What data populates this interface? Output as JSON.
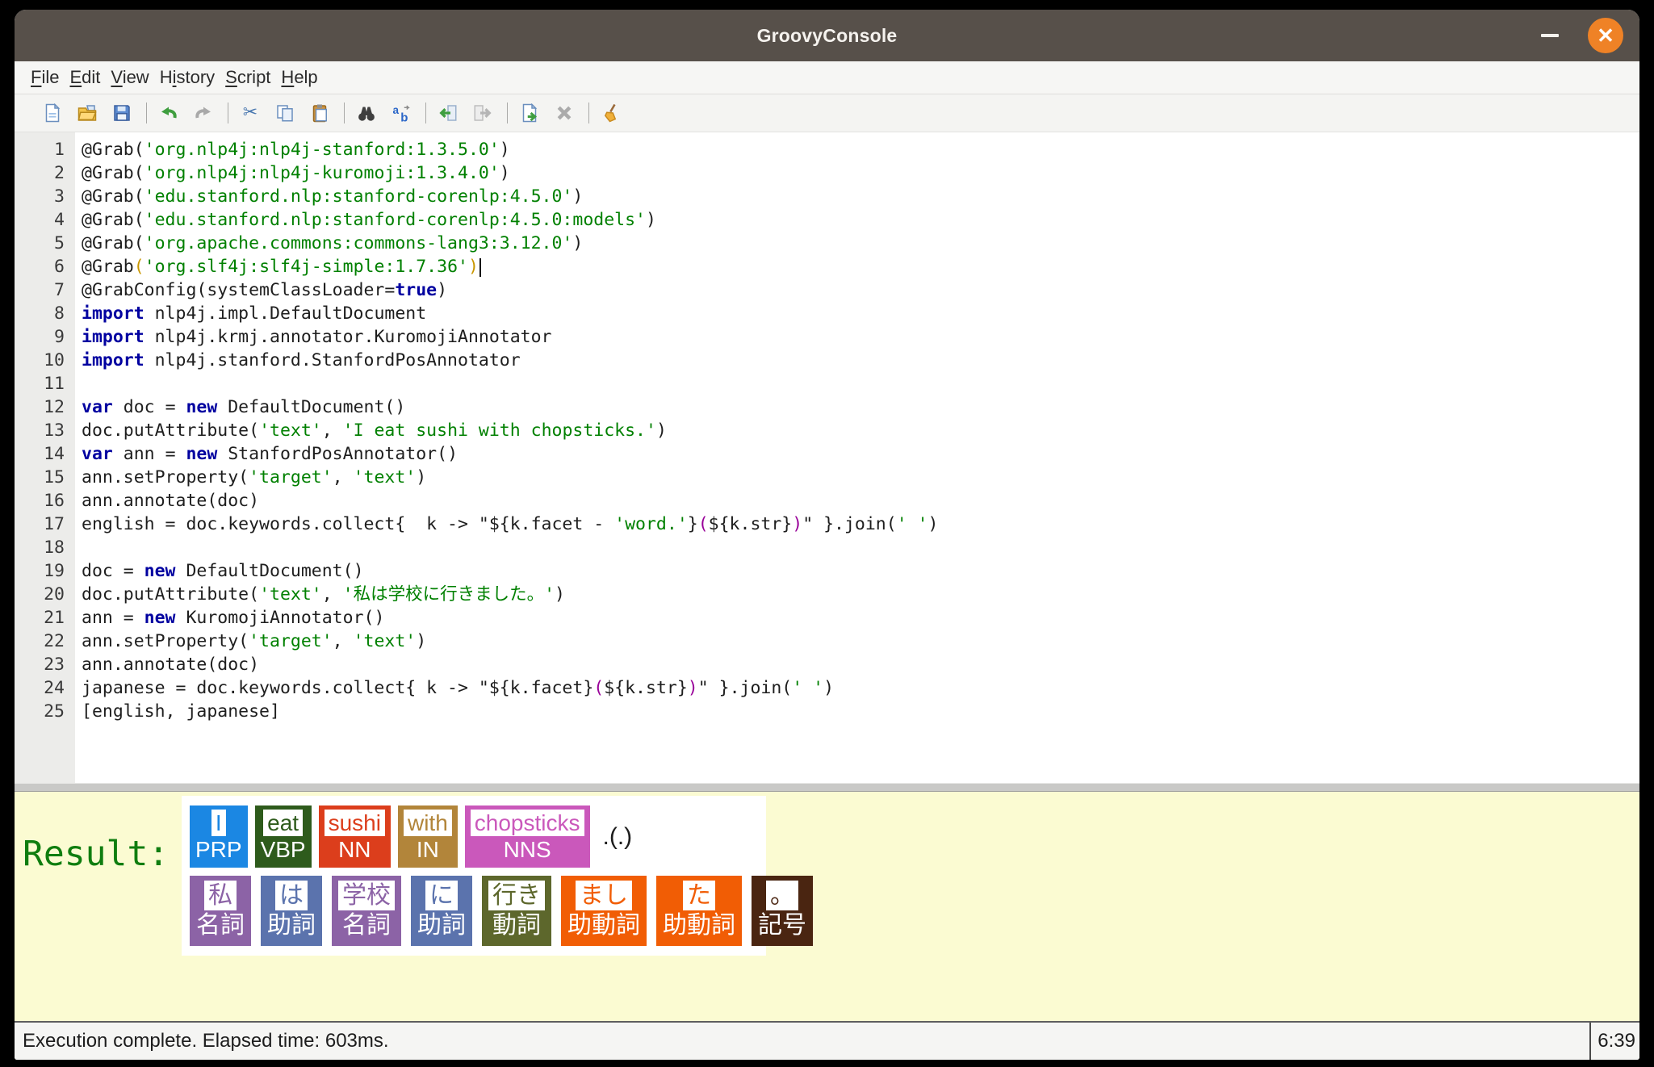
{
  "window": {
    "title": "GroovyConsole"
  },
  "titlebar_controls": {
    "minimize": "–",
    "close": "✕"
  },
  "menu": {
    "items": [
      {
        "pre": "",
        "m": "F",
        "post": "ile"
      },
      {
        "pre": "",
        "m": "E",
        "post": "dit"
      },
      {
        "pre": "",
        "m": "V",
        "post": "iew"
      },
      {
        "pre": "H",
        "m": "i",
        "post": "story"
      },
      {
        "pre": "",
        "m": "S",
        "post": "cript"
      },
      {
        "pre": "",
        "m": "H",
        "post": "elp"
      }
    ]
  },
  "toolbar": {
    "groups": [
      [
        "new-file",
        "open-file",
        "save"
      ],
      [
        "undo",
        "redo"
      ],
      [
        "cut",
        "copy",
        "paste"
      ],
      [
        "find",
        "replace"
      ],
      [
        "history-previous",
        "history-next"
      ],
      [
        "execute",
        "interrupt"
      ],
      [
        "clear-output"
      ]
    ]
  },
  "editor": {
    "lines": [
      {
        "no": 1,
        "segs": [
          {
            "t": "@Grab("
          },
          {
            "t": "'org.nlp4j:nlp4j-stanford:1.3.5.0'",
            "c": "s"
          },
          {
            "t": ")"
          }
        ]
      },
      {
        "no": 2,
        "segs": [
          {
            "t": "@Grab("
          },
          {
            "t": "'org.nlp4j:nlp4j-kuromoji:1.3.4.0'",
            "c": "s"
          },
          {
            "t": ")"
          }
        ]
      },
      {
        "no": 3,
        "segs": [
          {
            "t": "@Grab("
          },
          {
            "t": "'edu.stanford.nlp:stanford-corenlp:4.5.0'",
            "c": "s"
          },
          {
            "t": ")"
          }
        ]
      },
      {
        "no": 4,
        "segs": [
          {
            "t": "@Grab("
          },
          {
            "t": "'edu.stanford.nlp:stanford-corenlp:4.5.0:models'",
            "c": "s"
          },
          {
            "t": ")"
          }
        ]
      },
      {
        "no": 5,
        "segs": [
          {
            "t": "@Grab("
          },
          {
            "t": "'org.apache.commons:commons-lang3:3.12.0'",
            "c": "s"
          },
          {
            "t": ")"
          }
        ]
      },
      {
        "no": 6,
        "segs": [
          {
            "t": "@Grab"
          },
          {
            "t": "(",
            "c": "b"
          },
          {
            "t": "'org.slf4j:slf4j-simple:1.7.36'",
            "c": "s"
          },
          {
            "t": ")",
            "c": "b"
          },
          {
            "caret": true
          }
        ]
      },
      {
        "no": 7,
        "segs": [
          {
            "t": "@GrabConfig(systemClassLoader="
          },
          {
            "t": "true",
            "c": "k"
          },
          {
            "t": ")"
          }
        ]
      },
      {
        "no": 8,
        "segs": [
          {
            "t": "import",
            "c": "k"
          },
          {
            "t": " nlp4j.impl.DefaultDocument"
          }
        ]
      },
      {
        "no": 9,
        "segs": [
          {
            "t": "import",
            "c": "k"
          },
          {
            "t": " nlp4j.krmj.annotator.KuromojiAnnotator"
          }
        ]
      },
      {
        "no": 10,
        "segs": [
          {
            "t": "import",
            "c": "k"
          },
          {
            "t": " nlp4j.stanford.StanfordPosAnnotator"
          }
        ]
      },
      {
        "no": 11,
        "segs": []
      },
      {
        "no": 12,
        "segs": [
          {
            "t": "var",
            "c": "k"
          },
          {
            "t": " doc = "
          },
          {
            "t": "new",
            "c": "k"
          },
          {
            "t": " DefaultDocument()"
          }
        ]
      },
      {
        "no": 13,
        "segs": [
          {
            "t": "doc.putAttribute("
          },
          {
            "t": "'text'",
            "c": "s"
          },
          {
            "t": ", "
          },
          {
            "t": "'I eat sushi with chopsticks.'",
            "c": "s"
          },
          {
            "t": ")"
          }
        ]
      },
      {
        "no": 14,
        "segs": [
          {
            "t": "var",
            "c": "k"
          },
          {
            "t": " ann = "
          },
          {
            "t": "new",
            "c": "k"
          },
          {
            "t": " StanfordPosAnnotator()"
          }
        ]
      },
      {
        "no": 15,
        "segs": [
          {
            "t": "ann.setProperty("
          },
          {
            "t": "'target'",
            "c": "s"
          },
          {
            "t": ", "
          },
          {
            "t": "'text'",
            "c": "s"
          },
          {
            "t": ")"
          }
        ]
      },
      {
        "no": 16,
        "segs": [
          {
            "t": "ann.annotate(doc)"
          }
        ]
      },
      {
        "no": 17,
        "segs": [
          {
            "t": "english = doc.keywords.collect{  k -> \"${k.facet - "
          },
          {
            "t": "'word.'",
            "c": "s"
          },
          {
            "t": "}"
          },
          {
            "t": "(",
            "c": "p"
          },
          {
            "t": "${k.str}"
          },
          {
            "t": ")",
            "c": "p"
          },
          {
            "t": "\" }.join("
          },
          {
            "t": "' '",
            "c": "s"
          },
          {
            "t": ")"
          }
        ]
      },
      {
        "no": 18,
        "segs": []
      },
      {
        "no": 19,
        "segs": [
          {
            "t": "doc = "
          },
          {
            "t": "new",
            "c": "k"
          },
          {
            "t": " DefaultDocument()"
          }
        ]
      },
      {
        "no": 20,
        "segs": [
          {
            "t": "doc.putAttribute("
          },
          {
            "t": "'text'",
            "c": "s"
          },
          {
            "t": ", "
          },
          {
            "t": "'私は学校に行きました。'",
            "c": "s"
          },
          {
            "t": ")"
          }
        ]
      },
      {
        "no": 21,
        "segs": [
          {
            "t": "ann = "
          },
          {
            "t": "new",
            "c": "k"
          },
          {
            "t": " KuromojiAnnotator()"
          }
        ]
      },
      {
        "no": 22,
        "segs": [
          {
            "t": "ann.setProperty("
          },
          {
            "t": "'target'",
            "c": "s"
          },
          {
            "t": ", "
          },
          {
            "t": "'text'",
            "c": "s"
          },
          {
            "t": ")"
          }
        ]
      },
      {
        "no": 23,
        "segs": [
          {
            "t": "ann.annotate(doc)"
          }
        ]
      },
      {
        "no": 24,
        "segs": [
          {
            "t": "japanese = doc.keywords.collect{ k -> \"${k.facet}"
          },
          {
            "t": "(",
            "c": "p"
          },
          {
            "t": "${k.str}"
          },
          {
            "t": ")",
            "c": "p"
          },
          {
            "t": "\" }.join("
          },
          {
            "t": "' '",
            "c": "s"
          },
          {
            "t": ")"
          }
        ]
      },
      {
        "no": 25,
        "segs": [
          {
            "t": "[english, japanese]"
          }
        ]
      }
    ]
  },
  "result": {
    "label": "Result:",
    "english": [
      {
        "word": "I",
        "tag": "PRP",
        "color": "#1b87e3"
      },
      {
        "word": "eat",
        "tag": "VBP",
        "color": "#2e5b1c"
      },
      {
        "word": "sushi",
        "tag": "NN",
        "color": "#dc3e1c"
      },
      {
        "word": "with",
        "tag": "IN",
        "color": "#b2853a"
      },
      {
        "word": "chopsticks",
        "tag": "NNS",
        "color": "#ca58bb"
      }
    ],
    "english_extra": ".(.)",
    "japanese": [
      {
        "word": "私",
        "tag": "名詞",
        "color": "#8c63a6"
      },
      {
        "word": "は",
        "tag": "助詞",
        "color": "#5b73ad"
      },
      {
        "word": "学校",
        "tag": "名詞",
        "color": "#8c63a6"
      },
      {
        "word": "に",
        "tag": "助詞",
        "color": "#5b73ad"
      },
      {
        "word": "行き",
        "tag": "動詞",
        "color": "#5d672c"
      },
      {
        "word": "まし",
        "tag": "助動詞",
        "color": "#f15d05"
      },
      {
        "word": "た",
        "tag": "助動詞",
        "color": "#f15d05"
      },
      {
        "word": "。",
        "tag": "記号",
        "color": "#4a2511"
      }
    ]
  },
  "status": {
    "message": "Execution complete. Elapsed time: 603ms.",
    "time": "6:39"
  },
  "colors": {
    "titlebar": "#57504a",
    "close_button": "#ef8226",
    "output_background": "#fbfbd2",
    "string": "#008000",
    "keyword": "#0000a0",
    "gstring_literal": "#990099",
    "bracket_match": "#c99700",
    "result_label": "#0f7d0f"
  }
}
